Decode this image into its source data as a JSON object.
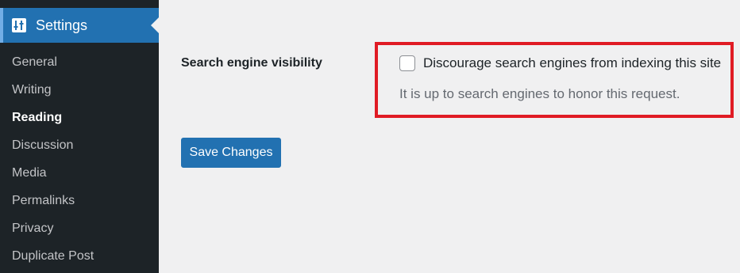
{
  "sidebar": {
    "section": {
      "label": "Settings",
      "icon": "settings-sliders-icon"
    },
    "items": [
      {
        "label": "General",
        "current": false
      },
      {
        "label": "Writing",
        "current": false
      },
      {
        "label": "Reading",
        "current": true
      },
      {
        "label": "Discussion",
        "current": false
      },
      {
        "label": "Media",
        "current": false
      },
      {
        "label": "Permalinks",
        "current": false
      },
      {
        "label": "Privacy",
        "current": false
      },
      {
        "label": "Duplicate Post",
        "current": false
      }
    ]
  },
  "main": {
    "field_label": "Search engine visibility",
    "checkbox": {
      "label": "Discourage search engines from indexing this site",
      "checked": false
    },
    "description": "It is up to search engines to honor this request.",
    "save_label": "Save Changes"
  },
  "colors": {
    "sidebar_bg": "#1d2327",
    "accent": "#2271b1",
    "highlight": "#e01b24",
    "page_bg": "#f0f0f1"
  }
}
